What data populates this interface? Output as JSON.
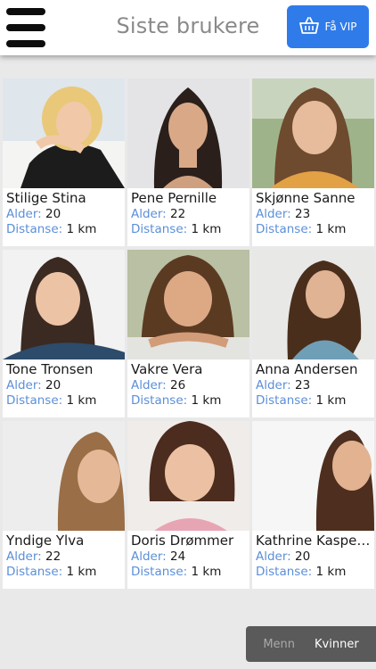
{
  "header": {
    "title": "Siste brukere",
    "vip_label": "Få VIP"
  },
  "profiles": [
    {
      "name": "Stilige Stina",
      "age_label": "Alder:",
      "age": "20",
      "distance_label": "Distanse:",
      "distance": "1 km"
    },
    {
      "name": "Pene Pernille",
      "age_label": "Alder:",
      "age": "22",
      "distance_label": "Distanse:",
      "distance": "1 km"
    },
    {
      "name": "Skjønne Sanne",
      "age_label": "Alder:",
      "age": "23",
      "distance_label": "Distanse:",
      "distance": "1 km"
    },
    {
      "name": "Tone Tronsen",
      "age_label": "Alder:",
      "age": "20",
      "distance_label": "Distanse:",
      "distance": "1 km"
    },
    {
      "name": "Vakre Vera",
      "age_label": "Alder:",
      "age": "26",
      "distance_label": "Distanse:",
      "distance": "1 km"
    },
    {
      "name": "Anna Andersen",
      "age_label": "Alder:",
      "age": "23",
      "distance_label": "Distanse:",
      "distance": "1 km"
    },
    {
      "name": "Yndige Ylva",
      "age_label": "Alder:",
      "age": "22",
      "distance_label": "Distanse:",
      "distance": "1 km"
    },
    {
      "name": "Doris Drømmer",
      "age_label": "Alder:",
      "age": "24",
      "distance_label": "Distanse:",
      "distance": "1 km"
    },
    {
      "name": "Kathrine Kasperse",
      "age_label": "Alder:",
      "age": "20",
      "distance_label": "Distanse:",
      "distance": "1 km"
    }
  ],
  "gender_toggle": {
    "men_label": "Menn",
    "women_label": "Kvinner",
    "selected": "Kvinner"
  },
  "colors": {
    "accent": "#2f7bea",
    "label_blue": "#5b8fd9",
    "background": "#e9e9ea"
  }
}
